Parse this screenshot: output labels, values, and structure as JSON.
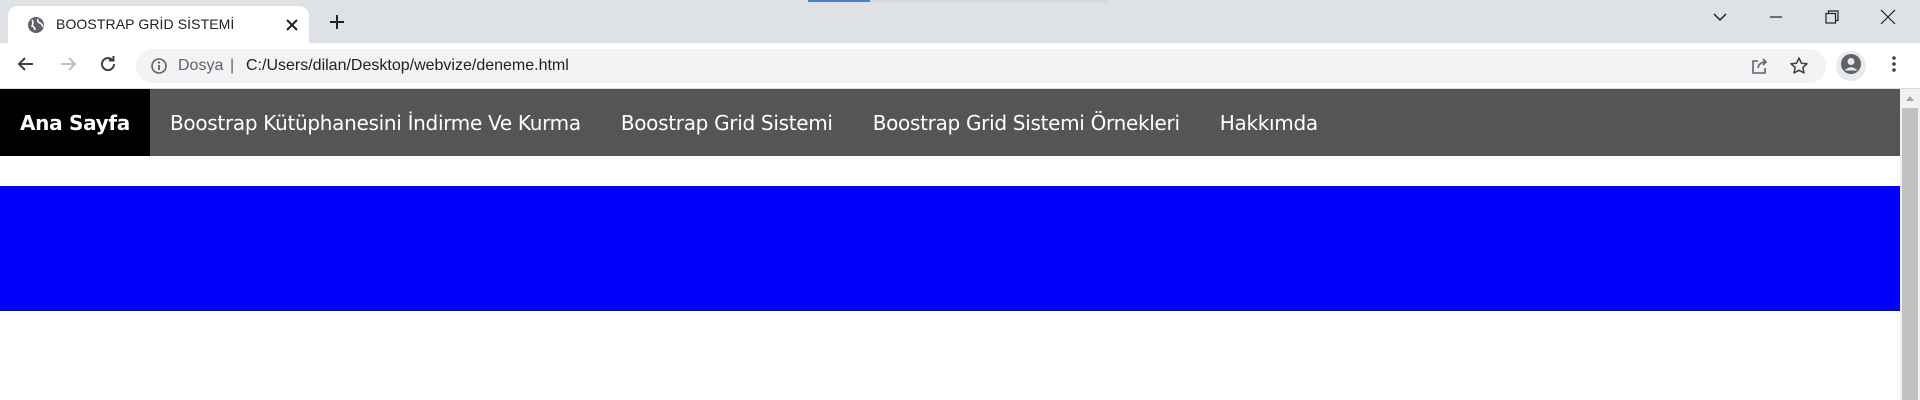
{
  "browser": {
    "tab": {
      "title": "BOOSTRAP GRİD SİSTEMİ",
      "favicon": "globe-icon"
    },
    "new_tab_icon": "plus-icon",
    "window_controls": [
      "chevron-down-icon",
      "minimize-icon",
      "restore-icon",
      "close-icon"
    ],
    "omnibox": {
      "security_label": "Dosya",
      "separator": "|",
      "url": "C:/Users/dilan/Desktop/webvize/deneme.html"
    },
    "colors": {
      "tabstrip": "#dee1e6",
      "omnibox": "#f1f3f4"
    }
  },
  "page": {
    "nav": {
      "items": [
        {
          "label": "Ana Sayfa",
          "active": true
        },
        {
          "label": "Boostrap Kütüphanesini İndirme Ve Kurma",
          "active": false
        },
        {
          "label": "Boostrap Grid Sistemi",
          "active": false
        },
        {
          "label": "Boostrap Grid Sistemi Örnekleri",
          "active": false
        },
        {
          "label": "Hakkımda",
          "active": false
        }
      ]
    },
    "colors": {
      "navbar": "#555555",
      "active_item": "#000000",
      "banner": "#0000ff"
    }
  }
}
